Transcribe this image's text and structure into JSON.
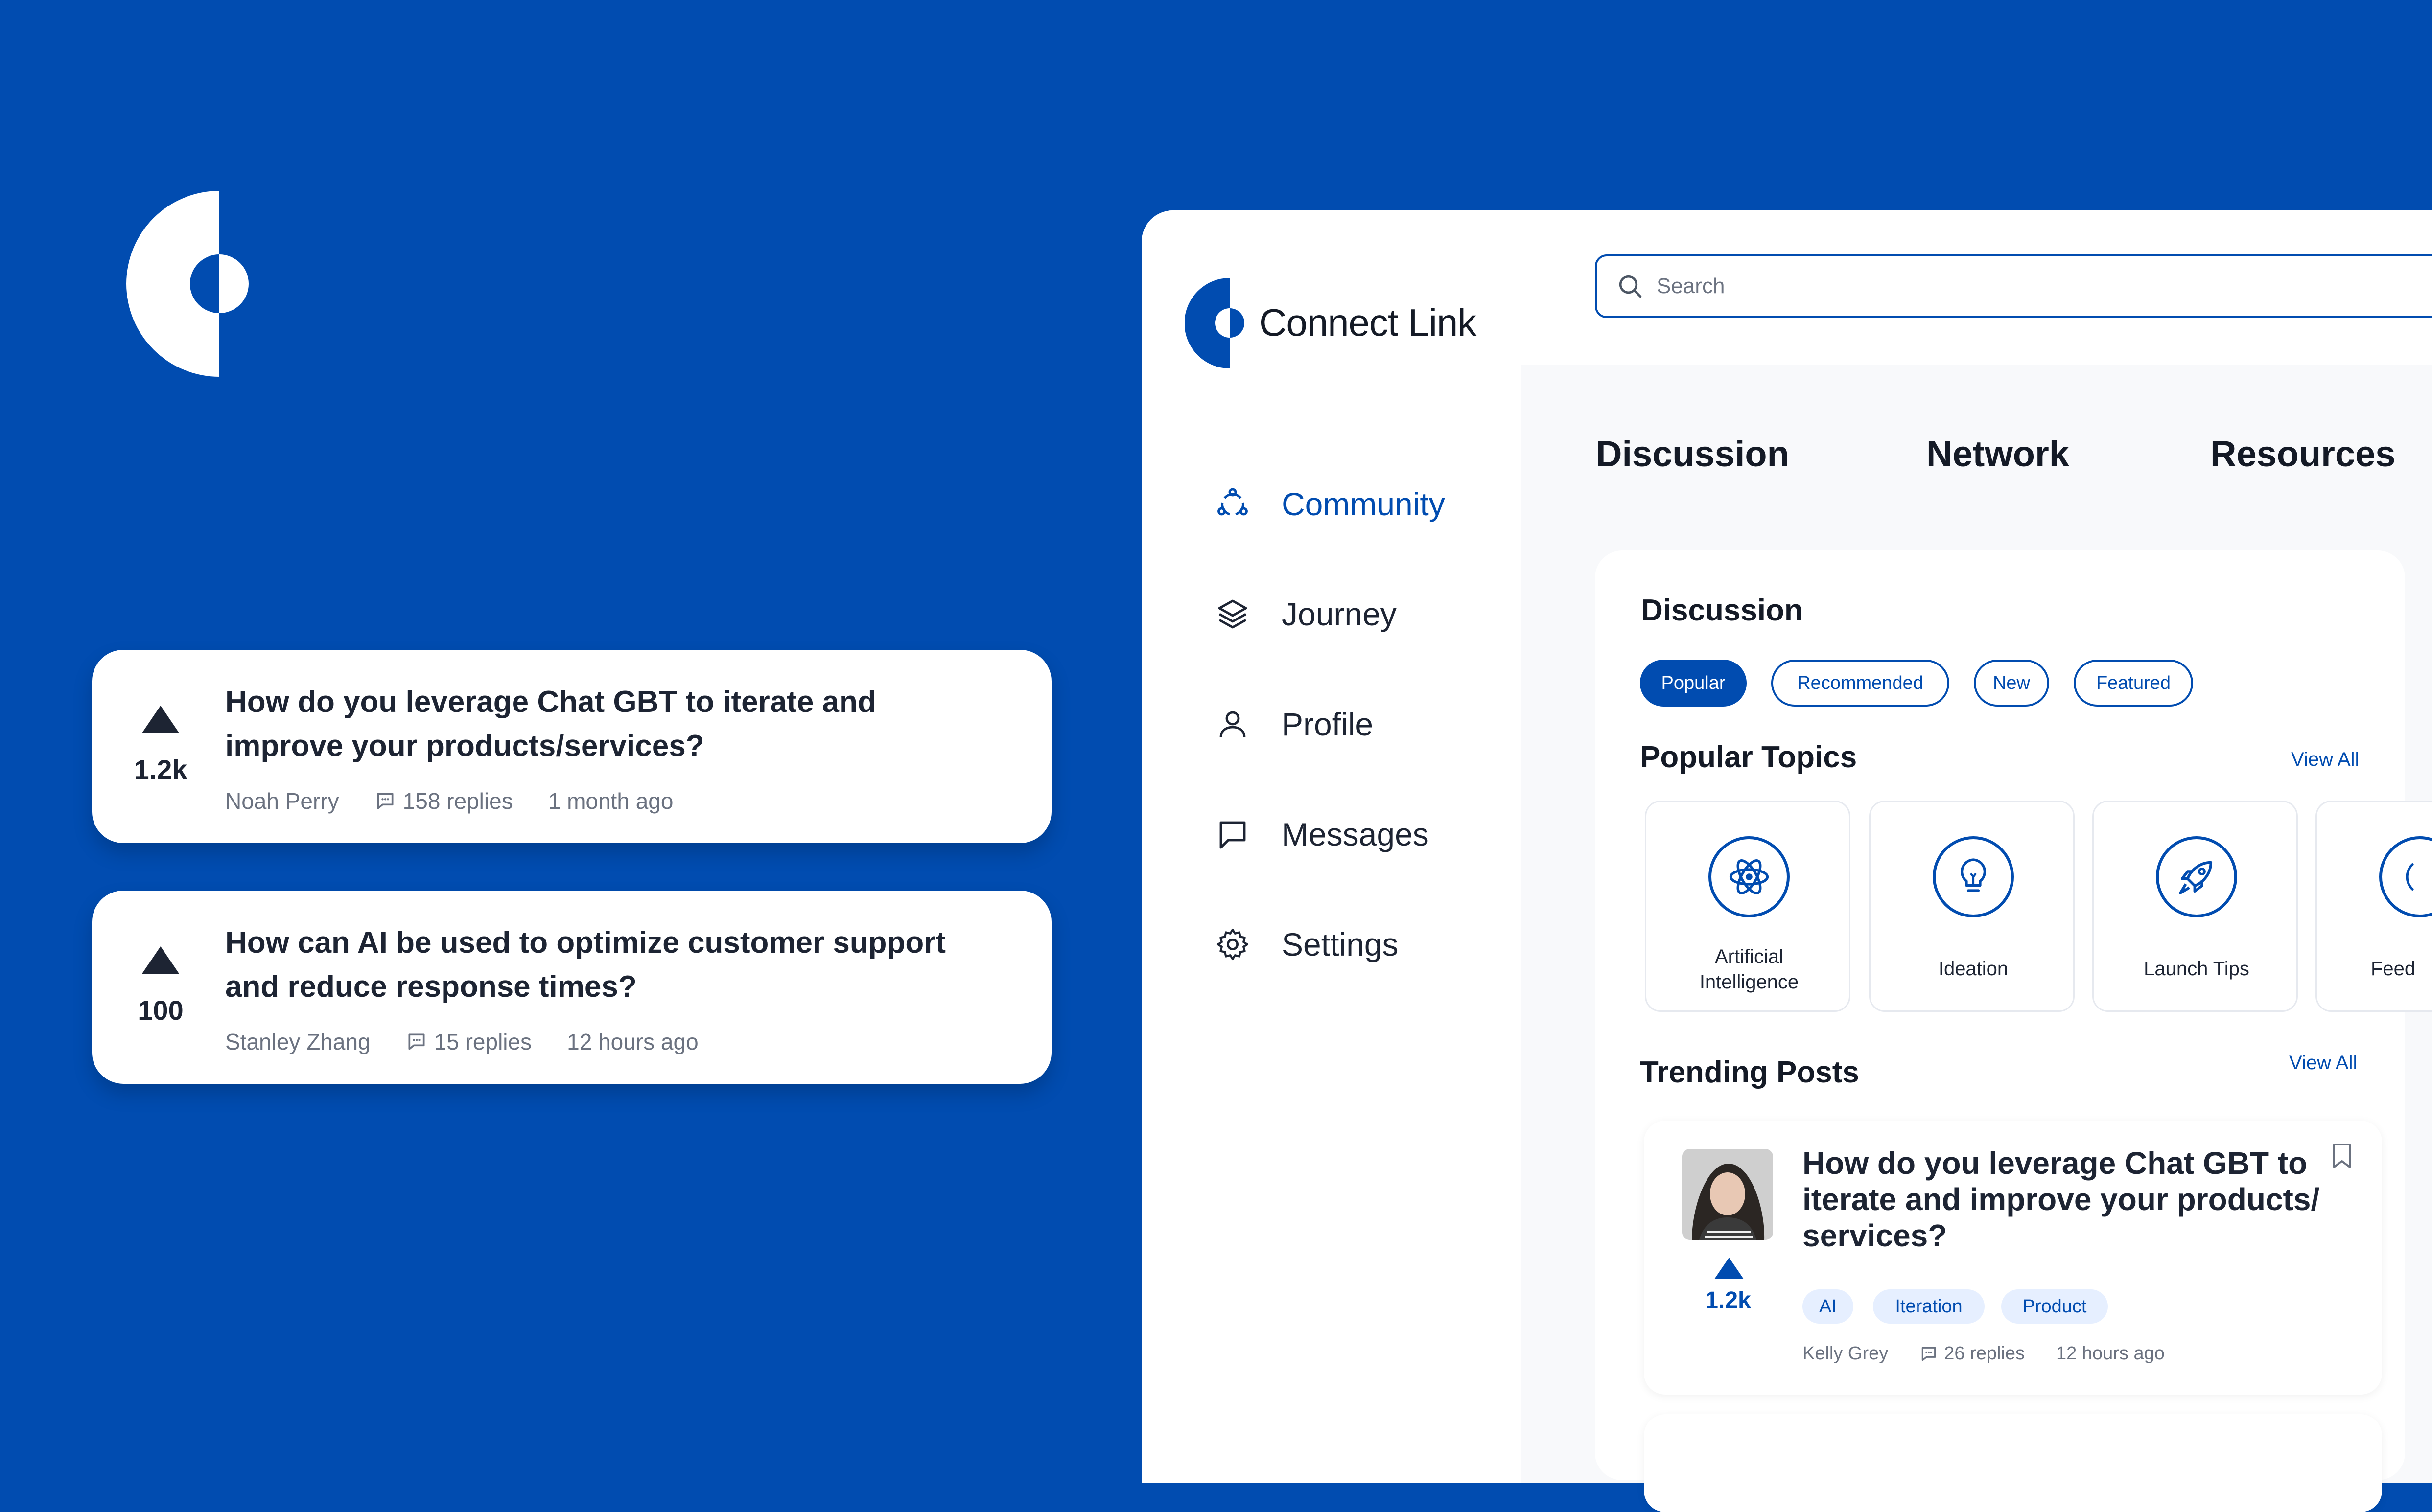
{
  "brand": {
    "name": "Connect Link",
    "accent": "#014CB0"
  },
  "floating_posts": [
    {
      "votes": "1.2k",
      "title_line1": "How do you leverage Chat GBT to iterate and",
      "title_line2": "improve your products/services?",
      "author": "Noah Perry",
      "replies": "158 replies",
      "time": "1 month ago"
    },
    {
      "votes": "100",
      "title_line1": "How can AI be used to optimize customer support",
      "title_line2": "and reduce response times?",
      "author": "Stanley Zhang",
      "replies": "15 replies",
      "time": "12 hours ago"
    }
  ],
  "sidebar": {
    "items": [
      {
        "label": "Community",
        "icon": "community-icon",
        "active": true
      },
      {
        "label": "Journey",
        "icon": "layers-icon"
      },
      {
        "label": "Profile",
        "icon": "user-icon"
      },
      {
        "label": "Messages",
        "icon": "message-icon"
      },
      {
        "label": "Settings",
        "icon": "gear-icon"
      }
    ]
  },
  "search": {
    "placeholder": "Search"
  },
  "tabs": [
    "Discussion",
    "Network",
    "Resources"
  ],
  "discussion": {
    "title": "Discussion",
    "filters": [
      "Popular",
      "Recommended",
      "New",
      "Featured"
    ],
    "active_filter": "Popular",
    "popular_topics": {
      "title": "Popular Topics",
      "view_all": "View All",
      "topics": [
        {
          "label_line1": "Artificial",
          "label_line2": "Intelligence",
          "icon": "atom-icon"
        },
        {
          "label_line1": "Ideation",
          "icon": "lightbulb-icon"
        },
        {
          "label_line1": "Launch Tips",
          "icon": "rocket-icon"
        },
        {
          "label_line1": "Feed",
          "icon": "feedback-icon"
        }
      ]
    },
    "trending": {
      "title": "Trending Posts",
      "view_all": "View All",
      "post": {
        "title_line1": "How do you leverage Chat GBT to",
        "title_line2": "iterate and improve your products/",
        "title_line3": "services?",
        "votes": "1.2k",
        "tags": [
          "AI",
          "Iteration",
          "Product"
        ],
        "author": "Kelly Grey",
        "replies": "26 replies",
        "time": "12 hours ago"
      }
    }
  }
}
